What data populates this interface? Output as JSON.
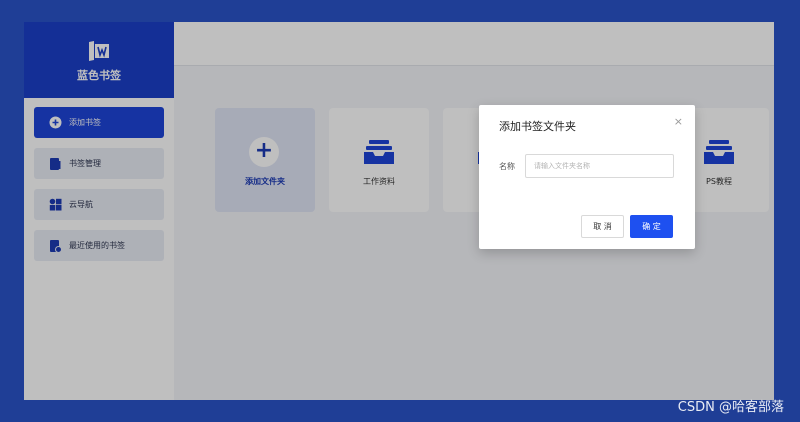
{
  "brand": {
    "name": "蓝色书签"
  },
  "sidebar": {
    "items": [
      {
        "label": "添加书签",
        "icon": "plus-circle-icon"
      },
      {
        "label": "书签管理",
        "icon": "book-icon"
      },
      {
        "label": "云导航",
        "icon": "grid-icon"
      },
      {
        "label": "最近使用的书签",
        "icon": "recent-doc-icon"
      }
    ]
  },
  "cards": [
    {
      "label": "添加文件夹",
      "icon": "plus-icon"
    },
    {
      "label": "工作资料",
      "icon": "inbox-folder-icon"
    },
    {
      "label": "",
      "icon": "inbox-folder-icon"
    },
    {
      "label": "PS教程",
      "icon": "inbox-folder-icon"
    }
  ],
  "modal": {
    "title": "添加书签文件夹",
    "close": "×",
    "field_label": "名称",
    "field_placeholder": "请输入文件夹名称",
    "field_value": "",
    "cancel_label": "取 消",
    "confirm_label": "确 定"
  },
  "watermark": "CSDN @哈客部落",
  "colors": {
    "brand": "#1b3fc9",
    "primary_button": "#1e50f0",
    "frame": "#1f3e96"
  }
}
